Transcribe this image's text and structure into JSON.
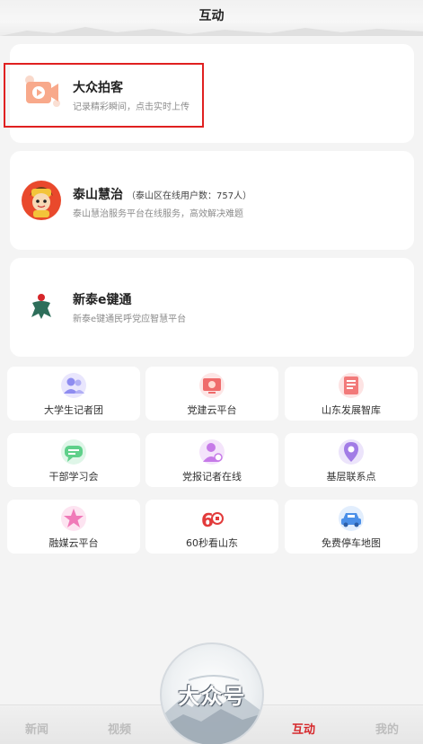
{
  "header": {
    "title": "互动"
  },
  "cards": [
    {
      "title": "大众拍客",
      "note": "",
      "subtitle": "记录精彩瞬间，点击实时上传",
      "icon": "video-camera-icon"
    },
    {
      "title": "泰山慧治",
      "note": "（泰山区在线用户数：757人）",
      "subtitle": "泰山慧治服务平台在线服务，高效解决难题",
      "icon": "avatar-mascot-icon"
    },
    {
      "title": "新泰e键通",
      "note": "",
      "subtitle": "新泰e键通民呼党应智慧平台",
      "icon": "logo-figure-icon"
    }
  ],
  "tiles": [
    {
      "label": "大学生记者团",
      "icon": "users-icon",
      "color": "#8e8cf0"
    },
    {
      "label": "党建云平台",
      "icon": "monitor-icon",
      "color": "#ef6b6b"
    },
    {
      "label": "山东发展智库",
      "icon": "newspaper-icon",
      "color": "#f27a7a"
    },
    {
      "label": "干部学习会",
      "icon": "chat-icon",
      "color": "#5fd08a"
    },
    {
      "label": "党报记者在线",
      "icon": "user-badge-icon",
      "color": "#c67ae8"
    },
    {
      "label": "基层联系点",
      "icon": "location-pin-icon",
      "color": "#a27ce6"
    },
    {
      "label": "融媒云平台",
      "icon": "star-icon",
      "color": "#f07ab8"
    },
    {
      "label": "60秒看山东",
      "icon": "sixty-logo-icon",
      "color": "#e23b3b"
    },
    {
      "label": "免费停车地图",
      "icon": "car-icon",
      "color": "#4a8fe8"
    }
  ],
  "tabs": [
    {
      "label": "新闻",
      "active": false
    },
    {
      "label": "视频",
      "active": false
    },
    {
      "label": "互动",
      "active": true
    },
    {
      "label": "我的",
      "active": false
    }
  ],
  "center_button": {
    "label": "大众号"
  },
  "colors": {
    "accent": "#d6262a",
    "highlight_border": "#e02020",
    "background": "#f4f4f4"
  }
}
